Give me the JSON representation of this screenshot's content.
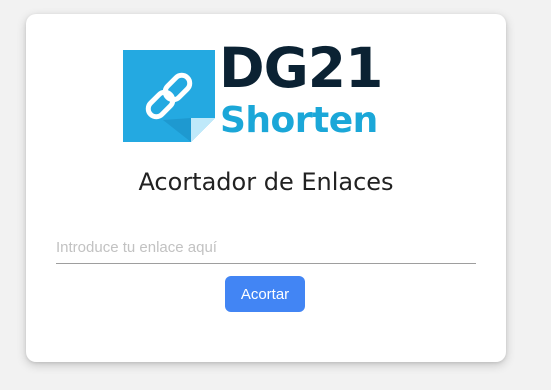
{
  "logo": {
    "text_top": "DG21",
    "text_bottom": "Shorten",
    "icon": "link-icon"
  },
  "title": "Acortador de Enlaces",
  "url_input": {
    "value": "",
    "placeholder": "Introduce tu enlace aquí"
  },
  "shorten_button": {
    "label": "Acortar"
  },
  "colors": {
    "background": "#f2f2f2",
    "card": "#ffffff",
    "button": "#4285f4",
    "logo_dark": "#0b2233",
    "logo_blue": "#1ba7d8"
  }
}
